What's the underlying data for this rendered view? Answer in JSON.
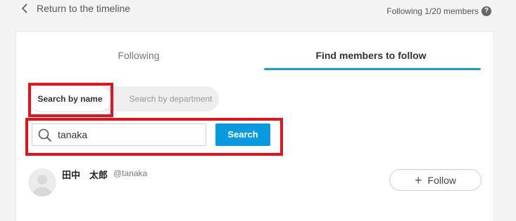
{
  "header": {
    "back_label": "Return to the timeline",
    "following_count": "Following 1/20 members"
  },
  "tabs": [
    {
      "label": "Following",
      "active": false
    },
    {
      "label": "Find members to follow",
      "active": true
    }
  ],
  "search_mode": {
    "options": [
      "Search by name",
      "Search by department"
    ],
    "selected": "Search by name"
  },
  "search": {
    "value": "tanaka",
    "button_label": "Search"
  },
  "results": [
    {
      "name": "田中　太郎",
      "handle": "@tanaka",
      "follow_label": "Follow"
    }
  ],
  "colors": {
    "accent": "#0a9ae0",
    "highlight": "#e3131b"
  },
  "icons": [
    "chevron-left-icon",
    "help-icon",
    "search-icon",
    "avatar-icon",
    "plus-icon"
  ]
}
